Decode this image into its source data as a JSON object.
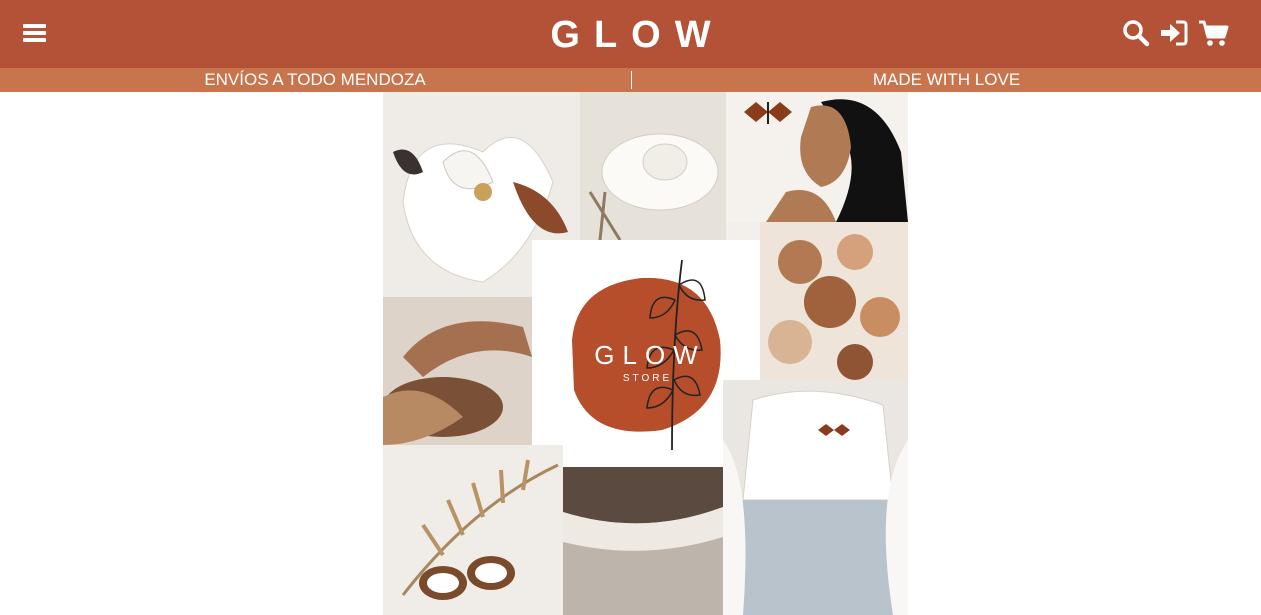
{
  "header": {
    "logo_text": "GLOW",
    "background_color": "#b35236",
    "icons": {
      "menu": "hamburger-menu-icon",
      "search": "search-icon",
      "login": "sign-in-icon",
      "cart": "shopping-cart-icon"
    }
  },
  "announcement_bar": {
    "background_color": "#c8744d",
    "left_text": "ENVÍOS A TODO MENDOZA",
    "right_text": "MADE WITH LOVE"
  },
  "hero": {
    "brand_name": "GLOW",
    "brand_subtitle": "STORE",
    "brand_color": "#b64e2c"
  }
}
